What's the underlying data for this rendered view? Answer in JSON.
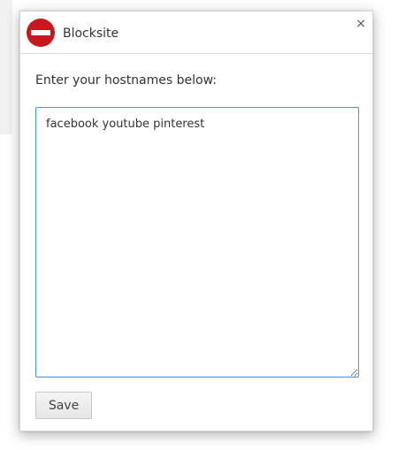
{
  "app": {
    "title": "Blocksite",
    "icon": "no-entry-icon",
    "icon_color": "#c8171d"
  },
  "header": {
    "close_label": "×"
  },
  "form": {
    "instruction": "Enter your hostnames below:",
    "hostnames_value": "facebook youtube pinterest",
    "save_label": "Save"
  },
  "colors": {
    "focus_border": "#4d90fe"
  }
}
